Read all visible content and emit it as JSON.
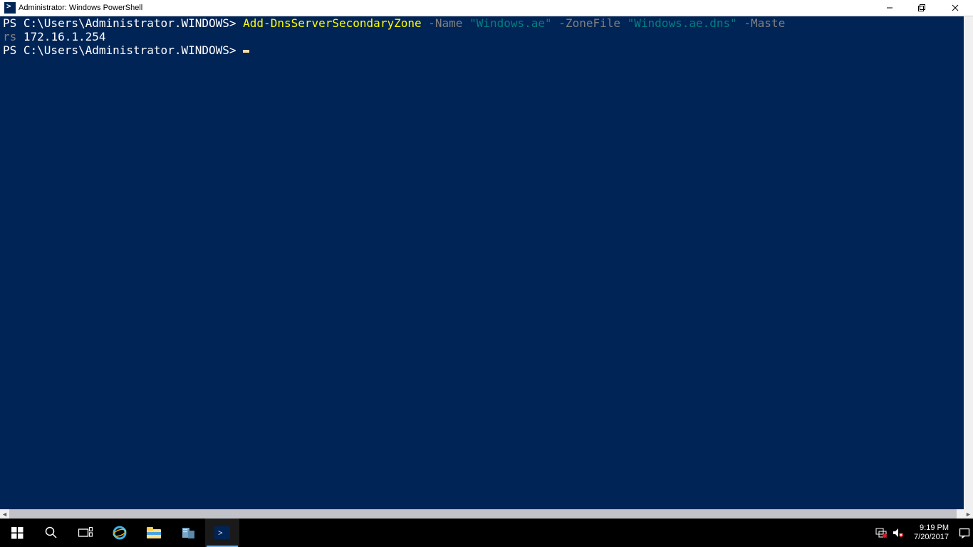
{
  "window": {
    "title": "Administrator: Windows PowerShell"
  },
  "terminal": {
    "line1": {
      "prompt": "PS C:\\Users\\Administrator.WINDOWS>",
      "cmdlet": "Add-DnsServerSecondaryZone",
      "param_name": "-Name",
      "val_name": "\"Windows.ae\"",
      "param_zonefile": "-ZoneFile",
      "val_zonefile": "\"Windows.ae.dns\"",
      "param_masters_part": "-Maste"
    },
    "line2": {
      "param_rs": "rs",
      "val_ip": "172.16.1.254"
    },
    "line3": {
      "prompt": "PS C:\\Users\\Administrator.WINDOWS>"
    }
  },
  "taskbar": {
    "time": "9:19 PM",
    "date": "7/20/2017"
  }
}
